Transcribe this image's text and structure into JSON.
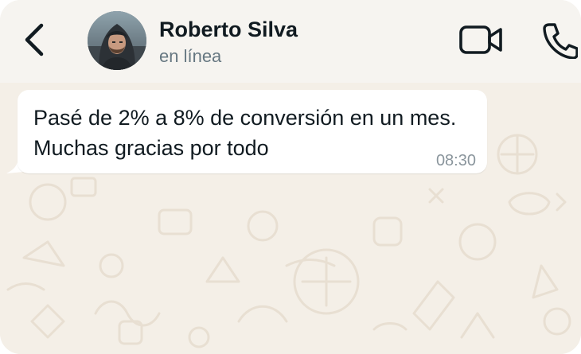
{
  "header": {
    "contact_name": "Roberto Silva",
    "status": "en línea",
    "icons": {
      "back": "back-arrow-icon",
      "video": "video-call-icon",
      "phone": "phone-call-icon"
    }
  },
  "messages": [
    {
      "direction": "incoming",
      "text": "Pasé de 2% a 8% de conversión en un mes. Muchas gracias por todo",
      "time": "08:30"
    }
  ],
  "colors": {
    "header_bg": "#f6f4f0",
    "chat_bg": "#f4efe7",
    "bubble_bg": "#ffffff",
    "text": "#111b21",
    "secondary_text": "#667781"
  }
}
